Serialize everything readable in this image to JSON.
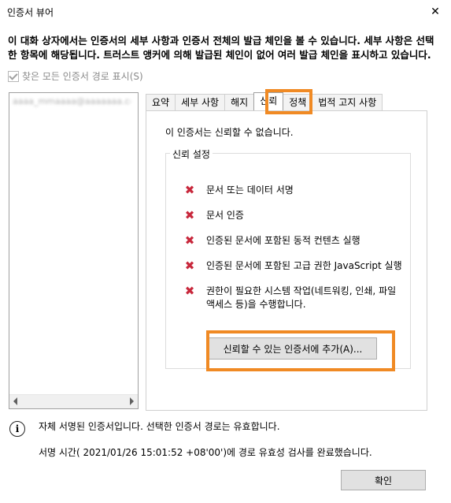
{
  "window": {
    "title": "인증서 뷰어",
    "close_label": "✕"
  },
  "header": {
    "description": "이 대화 상자에서는 인증서의 세부 사항과 인증서 전체의 발급 체인을 볼 수 있습니다. 세부 사항은 선택한 항목에 해당됩니다. 트러스트 앵커에 의해 발급된 체인이 없어 여러 발급 체인을 표시하고 있습니다."
  },
  "show_all_paths": {
    "label": "찾은 모든 인증서 경로 표시(S)",
    "checked": true,
    "enabled": false
  },
  "cert_path": {
    "item_label": "aaaa_mmaaaa@aaaaaaa.com"
  },
  "tabs": [
    {
      "label": "요약",
      "active": false
    },
    {
      "label": "세부 사항",
      "active": false
    },
    {
      "label": "해지",
      "active": false
    },
    {
      "label": "신뢰",
      "active": true
    },
    {
      "label": "정책",
      "active": false
    },
    {
      "label": "법적 고지 사항",
      "active": false
    }
  ],
  "trust": {
    "status": "이 인증서는 신뢰할 수 없습니다.",
    "group_label": "신뢰 설정",
    "items": [
      {
        "line1": "문서 또는 데이터 서명",
        "line2": ""
      },
      {
        "line1": "문서 인증",
        "line2": ""
      },
      {
        "line1": "인증된 문서에 포함된 동적 컨텐츠 실행",
        "line2": ""
      },
      {
        "line1": "인증된 문서에 포함된 고급 권한 JavaScript 실행",
        "line2": ""
      },
      {
        "line1": "권한이 필요한 시스템 작업(네트워킹, 인쇄, 파일",
        "line2": "액세스 등)을 수행합니다."
      }
    ],
    "item_icon": "red-x-icon",
    "add_button_label": "신뢰할 수 있는 인증서에 추가(A)..."
  },
  "messages": {
    "info_icon": "i",
    "line1": "자체 서명된 인증서입니다. 선택한 인증서 경로는 유효합니다.",
    "line2": "서명 시간( 2021/01/26 15:01:52 +08'00')에 경로 유효성 검사를 완료했습니다."
  },
  "ok_label": "확인",
  "colors": {
    "highlight": "#f08a24",
    "x_icon": "#c8283c"
  }
}
